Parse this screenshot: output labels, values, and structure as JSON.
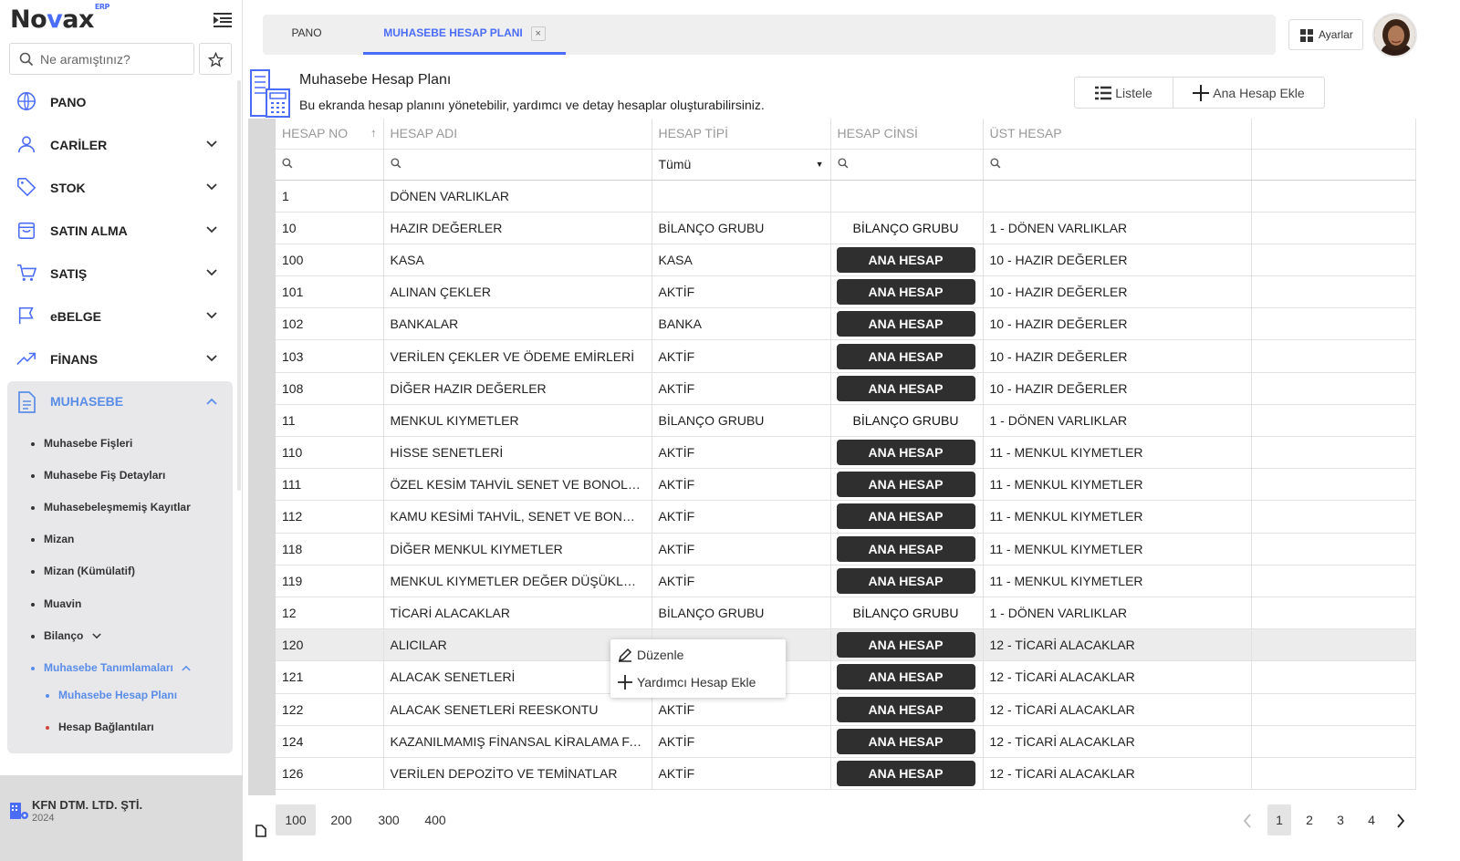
{
  "app": {
    "logo_a": "No",
    "logo_v": "v",
    "logo_b": "ax",
    "logo_sup": "ERP"
  },
  "search": {
    "placeholder": "Ne aramıştınız?"
  },
  "nav": [
    {
      "label": "PANO",
      "icon": "globe-icon"
    },
    {
      "label": "CARİLER",
      "icon": "user-icon"
    },
    {
      "label": "STOK",
      "icon": "tag-icon"
    },
    {
      "label": "SATIN ALMA",
      "icon": "shopping-bag-icon"
    },
    {
      "label": "SATIŞ",
      "icon": "cart-icon"
    },
    {
      "label": "eBELGE",
      "icon": "flag-icon"
    },
    {
      "label": "FİNANS",
      "icon": "trend-icon"
    }
  ],
  "accounting": {
    "label": "MUHASEBE",
    "items": [
      "Muhasebe Fişleri",
      "Muhasebe Fiş Detayları",
      "Muhasebeleşmemiş Kayıtlar",
      "Mizan",
      "Mizan (Kümülatif)",
      "Muavin",
      "Bilanço"
    ],
    "defs_label": "Muhasebe Tanımlamaları",
    "defs_items": [
      "Muhasebe Hesap Planı",
      "Hesap Bağlantıları"
    ]
  },
  "company": {
    "name": "KFN DTM. LTD. ŞTİ.",
    "year": "2024"
  },
  "tabs": {
    "home": "PANO",
    "active": "MUHASEBE HESAP PLANI",
    "close": "×"
  },
  "settings_label": "Ayarlar",
  "page": {
    "title": "Muhasebe Hesap Planı",
    "desc": "Bu ekranda hesap planını yönetebilir, yardımcı ve detay hesaplar oluşturabilirsiniz.",
    "list_btn": "Listele",
    "add_btn": "Ana Hesap Ekle"
  },
  "columns": [
    "HESAP NO",
    "HESAP ADI",
    "HESAP TİPİ",
    "HESAP CİNSİ",
    "ÜST HESAP"
  ],
  "filter_type": "Tümü",
  "rows": [
    {
      "no": "1",
      "name": "DÖNEN VARLIKLAR",
      "type": "",
      "kind": "",
      "kind_style": "",
      "parent": ""
    },
    {
      "no": "10",
      "name": "HAZIR DEĞERLER",
      "type": "BİLANÇO GRUBU",
      "kind": "BİLANÇO GRUBU",
      "kind_style": "plain",
      "parent": "1 - DÖNEN VARLIKLAR"
    },
    {
      "no": "100",
      "name": "KASA",
      "type": "KASA",
      "kind": "ANA HESAP",
      "kind_style": "tag",
      "parent": "10 - HAZIR DEĞERLER"
    },
    {
      "no": "101",
      "name": "ALINAN ÇEKLER",
      "type": "AKTİF",
      "kind": "ANA HESAP",
      "kind_style": "tag",
      "parent": "10 - HAZIR DEĞERLER"
    },
    {
      "no": "102",
      "name": "BANKALAR",
      "type": "BANKA",
      "kind": "ANA HESAP",
      "kind_style": "tag",
      "parent": "10 - HAZIR DEĞERLER"
    },
    {
      "no": "103",
      "name": "VERİLEN ÇEKLER VE ÖDEME EMİRLERİ",
      "type": "AKTİF",
      "kind": "ANA HESAP",
      "kind_style": "tag",
      "parent": "10 - HAZIR DEĞERLER"
    },
    {
      "no": "108",
      "name": "DİĞER HAZIR DEĞERLER",
      "type": "AKTİF",
      "kind": "ANA HESAP",
      "kind_style": "tag",
      "parent": "10 - HAZIR DEĞERLER"
    },
    {
      "no": "11",
      "name": "MENKUL KIYMETLER",
      "type": "BİLANÇO GRUBU",
      "kind": "BİLANÇO GRUBU",
      "kind_style": "plain",
      "parent": "1 - DÖNEN VARLIKLAR"
    },
    {
      "no": "110",
      "name": "HİSSE SENETLERİ",
      "type": "AKTİF",
      "kind": "ANA HESAP",
      "kind_style": "tag",
      "parent": "11 - MENKUL KIYMETLER"
    },
    {
      "no": "111",
      "name": "ÖZEL KESİM TAHVİL SENET VE BONOLARI",
      "type": "AKTİF",
      "kind": "ANA HESAP",
      "kind_style": "tag",
      "parent": "11 - MENKUL KIYMETLER"
    },
    {
      "no": "112",
      "name": "KAMU KESİMİ TAHVİL, SENET VE BONOLARI",
      "type": "AKTİF",
      "kind": "ANA HESAP",
      "kind_style": "tag",
      "parent": "11 - MENKUL KIYMETLER"
    },
    {
      "no": "118",
      "name": "DİĞER MENKUL KIYMETLER",
      "type": "AKTİF",
      "kind": "ANA HESAP",
      "kind_style": "tag",
      "parent": "11 - MENKUL KIYMETLER"
    },
    {
      "no": "119",
      "name": "MENKUL KIYMETLER DEĞER DÜŞÜKLÜĞÜ KARŞILIĞI",
      "type": "AKTİF",
      "kind": "ANA HESAP",
      "kind_style": "tag",
      "parent": "11 - MENKUL KIYMETLER"
    },
    {
      "no": "12",
      "name": "TİCARİ ALACAKLAR",
      "type": "BİLANÇO GRUBU",
      "kind": "BİLANÇO GRUBU",
      "kind_style": "plain",
      "parent": "1 - DÖNEN VARLIKLAR"
    },
    {
      "no": "120",
      "name": "ALICILAR",
      "type": "",
      "kind": "ANA HESAP",
      "kind_style": "tag",
      "parent": "12 - TİCARİ ALACAKLAR"
    },
    {
      "no": "121",
      "name": "ALACAK SENETLERİ",
      "type": "",
      "kind": "ANA HESAP",
      "kind_style": "tag",
      "parent": "12 - TİCARİ ALACAKLAR"
    },
    {
      "no": "122",
      "name": "ALACAK SENETLERİ REESKONTU",
      "type": "AKTİF",
      "kind": "ANA HESAP",
      "kind_style": "tag",
      "parent": "12 - TİCARİ ALACAKLAR"
    },
    {
      "no": "124",
      "name": "KAZANILMAMIŞ FİNANSAL KİRALAMA FAİZ GELİRLERİ",
      "type": "AKTİF",
      "kind": "ANA HESAP",
      "kind_style": "tag",
      "parent": "12 - TİCARİ ALACAKLAR"
    },
    {
      "no": "126",
      "name": "VERİLEN DEPOZİTO VE TEMİNATLAR",
      "type": "AKTİF",
      "kind": "ANA HESAP",
      "kind_style": "tag",
      "parent": "12 - TİCARİ ALACAKLAR"
    }
  ],
  "context_menu": [
    "Düzenle",
    "Yardımcı Hesap Ekle"
  ],
  "page_sizes": [
    "100",
    "200",
    "300",
    "400"
  ],
  "pages": [
    "1",
    "2",
    "3",
    "4"
  ]
}
